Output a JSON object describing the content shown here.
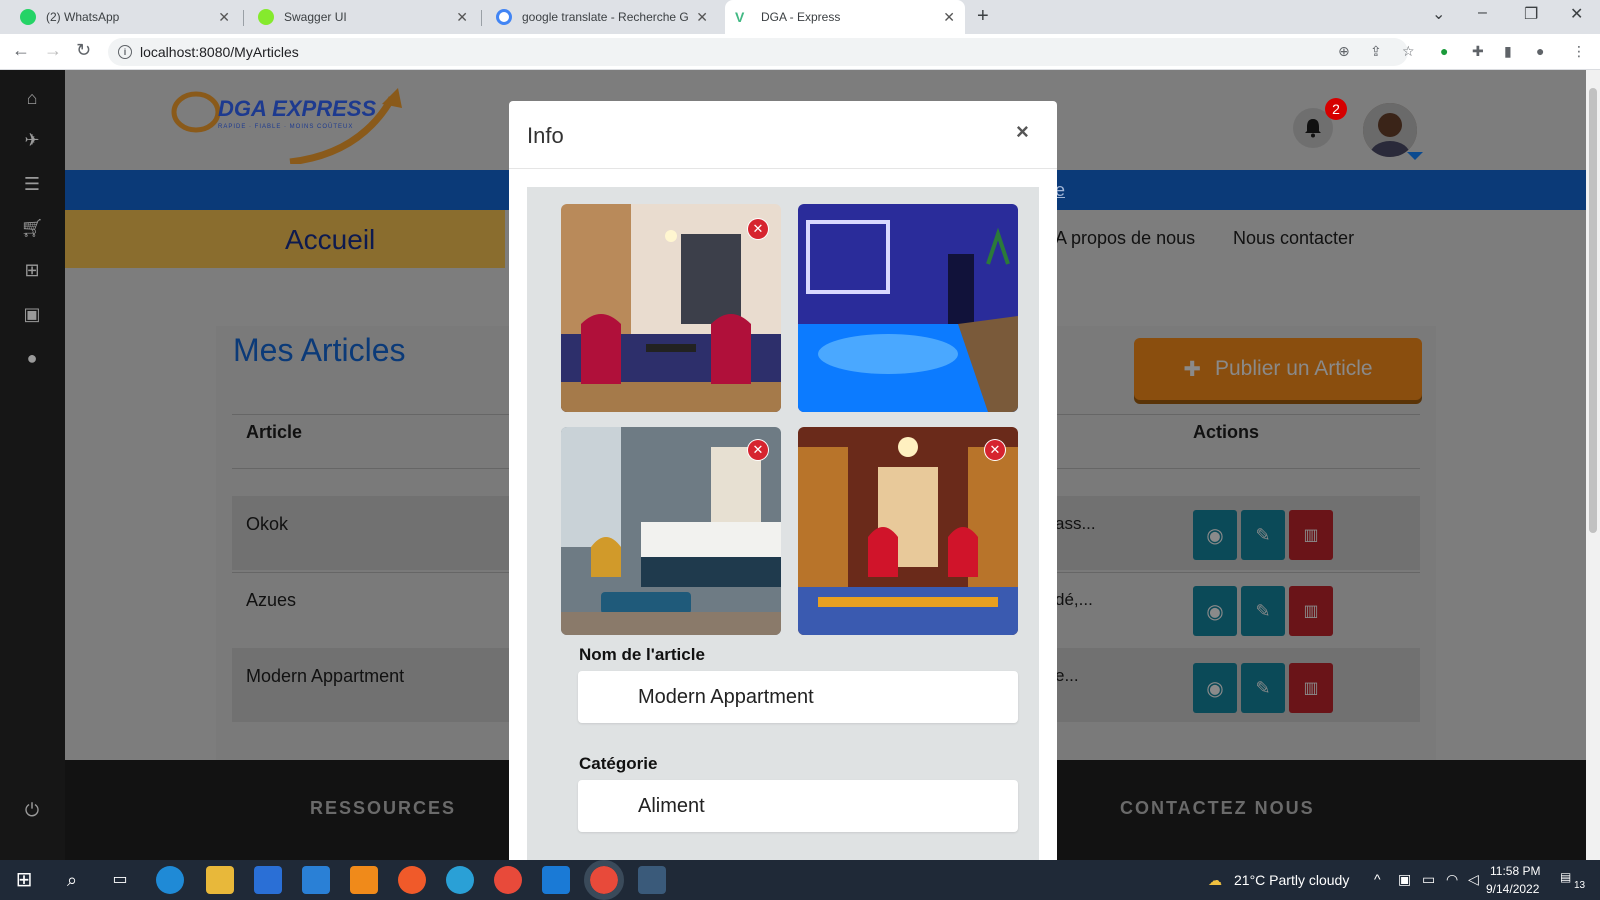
{
  "browser": {
    "tabs": [
      {
        "title": "(2) WhatsApp",
        "favicon": "whatsapp-icon",
        "color": "#25d366"
      },
      {
        "title": "Swagger UI",
        "favicon": "swagger-icon",
        "color": "#85ea2d"
      },
      {
        "title": "google translate - Recherche Goo",
        "favicon": "google-icon",
        "color": "#4285f4"
      },
      {
        "title": "DGA - Express",
        "favicon": "vue-icon",
        "color": "#41b883"
      }
    ],
    "url": "localhost:8080/MyArticles"
  },
  "header": {
    "logo_text": "DGA EXPRESS",
    "logo_tagline": "RAPIDE · FIABLE · MOINS COÛTEUX",
    "notification_count": "2"
  },
  "nav": {
    "accueil": "Accueil",
    "about": "A propos de nous",
    "contact": "Nous contacter",
    "bluebar_link": "e"
  },
  "main": {
    "title": "Mes Articles",
    "publish_button": "Publier un Article",
    "columns": {
      "article": "Article",
      "actions": "Actions"
    },
    "rows": [
      {
        "name": "Okok",
        "desc": "ass..."
      },
      {
        "name": "Azues",
        "desc": "dé,..."
      },
      {
        "name": "Modern Appartment",
        "desc": "e..."
      }
    ]
  },
  "footer": {
    "resources": "RESSOURCES",
    "contact": "CONTACTEZ NOUS"
  },
  "modal": {
    "title": "Info",
    "close": "×",
    "photos": [
      "restaurant-photo",
      "pool-photo",
      "bedroom-photo",
      "lounge-photo"
    ],
    "name_label": "Nom de l'article",
    "name_value": "Modern Appartment",
    "category_label": "Catégorie",
    "category_value": "Aliment"
  },
  "taskbar": {
    "weather": "21°C  Partly cloudy",
    "time": "11:58 PM",
    "date": "9/14/2022",
    "notifications": "13"
  }
}
